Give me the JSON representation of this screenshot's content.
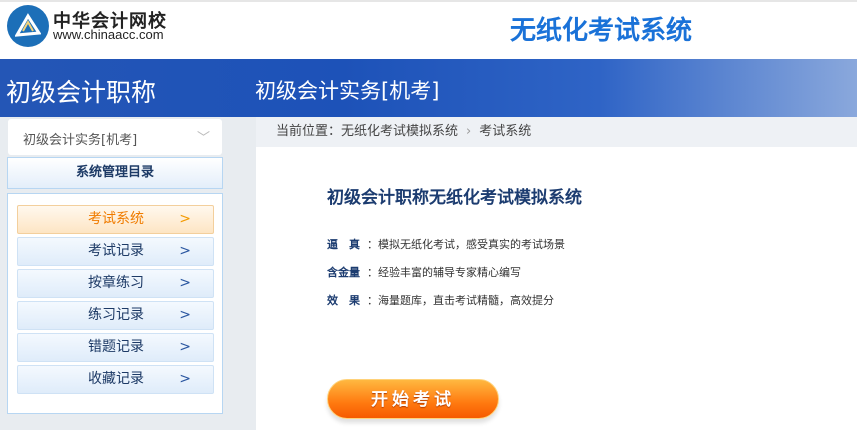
{
  "header": {
    "logo_cn": "中华会计网校",
    "logo_en": "www.chinaacc.com",
    "system_title": "无纸化考试系统"
  },
  "banner": {
    "left_title": "初级会计职称",
    "right_title": "初级会计实务[机考]"
  },
  "sidebar": {
    "course_select": "初级会计实务[机考]",
    "menu_title": "系统管理目录",
    "items": [
      {
        "label": "考试系统"
      },
      {
        "label": "考试记录"
      },
      {
        "label": "按章练习"
      },
      {
        "label": "练习记录"
      },
      {
        "label": "错题记录"
      },
      {
        "label": "收藏记录"
      }
    ]
  },
  "breadcrumb": {
    "prefix": "当前位置：",
    "path1": "无纸化考试模拟系统",
    "path2": "考试系统"
  },
  "main": {
    "title": "初级会计职称无纸化考试模拟系统",
    "features": [
      {
        "key": "逼　真",
        "text": "：模拟无纸化考试，感受真实的考试场景"
      },
      {
        "key": "含金量",
        "text": "：经验丰富的辅导专家精心编写"
      },
      {
        "key": "效　果",
        "text": "：海量题库，直击考试精髓，高效提分"
      }
    ],
    "start_button": "开始考试"
  }
}
